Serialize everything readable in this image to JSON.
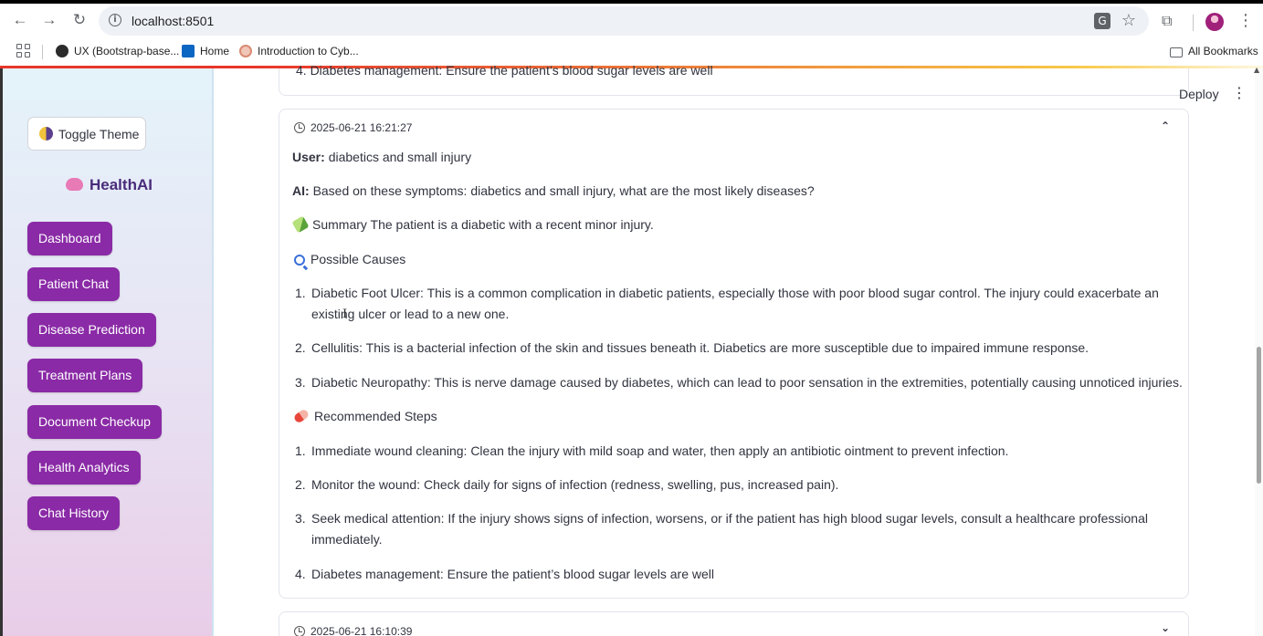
{
  "browser": {
    "url": "localhost:8501",
    "bookmarks": [
      "UX (Bootstrap-base...",
      "Home",
      "Introduction to Cyb..."
    ],
    "all_bookmarks": "All Bookmarks",
    "icons": [
      "back-icon",
      "forward-icon",
      "reload-icon",
      "info-icon",
      "translate-icon",
      "star-icon",
      "extensions-icon",
      "profile-avatar",
      "more-icon",
      "apps-icon",
      "folder-icon"
    ]
  },
  "sidebar": {
    "toggle_theme": "Toggle Theme",
    "brand": "HealthAI",
    "nav": [
      "Dashboard",
      "Patient Chat",
      "Disease Prediction",
      "Treatment Plans",
      "Document Checkup",
      "Health Analytics",
      "Chat History"
    ]
  },
  "header": {
    "deploy": "Deploy"
  },
  "previous_entry_tail": "4.  Diabetes management: Ensure the patient’s blood sugar levels are well",
  "entry": {
    "timestamp": "2025-06-21 16:21:27",
    "user_label": "User:",
    "user_text": "diabetics and small injury",
    "ai_label": "AI:",
    "ai_text": "Based on these symptoms: diabetics and small injury, what are the most likely diseases?",
    "summary": "Summary The patient is a diabetic with a recent minor injury.",
    "causes_heading": "Possible Causes",
    "causes": [
      {
        "num": "1.",
        "line1": "Diabetic Foot Ulcer: This is a common complication in diabetic patients, especially those with poor blood sugar control. The injury could exacerbate an",
        "line2": "existing ulcer or lead to a new one."
      },
      {
        "num": "2.",
        "line1": "Cellulitis: This is a bacterial infection of the skin and tissues beneath it. Diabetics are more susceptible due to impaired immune response."
      },
      {
        "num": "3.",
        "line1": "Diabetic Neuropathy: This is nerve damage caused by diabetes, which can lead to poor sensation in the extremities, potentially causing unnoticed injuries."
      }
    ],
    "steps_heading": "Recommended Steps",
    "steps": [
      {
        "num": "1.",
        "line1": "Immediate wound cleaning: Clean the injury with mild soap and water, then apply an antibiotic ointment to prevent infection."
      },
      {
        "num": "2.",
        "line1": "Monitor the wound: Check daily for signs of infection (redness, swelling, pus, increased pain)."
      },
      {
        "num": "3.",
        "line1": "Seek medical attention: If the injury shows signs of infection, worsens, or if the patient has high blood sugar levels, consult a healthcare professional",
        "line2": "immediately."
      },
      {
        "num": "4.",
        "line1": "Diabetes management: Ensure the patient’s blood sugar levels are well"
      }
    ]
  },
  "next_entry": {
    "timestamp": "2025-06-21 16:10:39"
  }
}
